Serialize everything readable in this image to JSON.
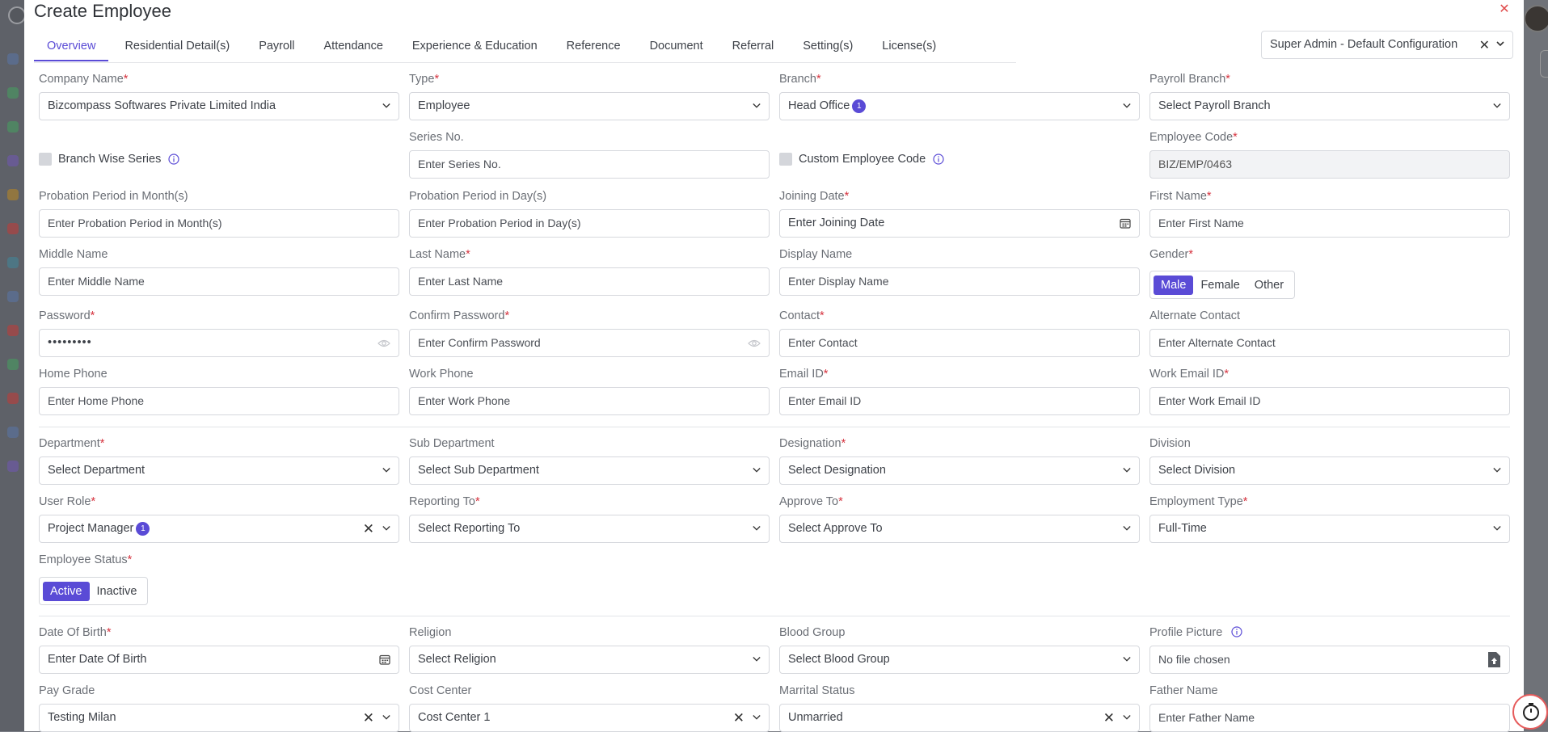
{
  "modal": {
    "title": "Create Employee",
    "config_select": "Super Admin - Default Configuration"
  },
  "tabs": [
    "Overview",
    "Residential Detail(s)",
    "Payroll",
    "Attendance",
    "Experience & Education",
    "Reference",
    "Document",
    "Referral",
    "Setting(s)",
    "License(s)"
  ],
  "colors": {
    "accent": "#5a4bd6",
    "required": "#d6333f",
    "close": "#e04b4b"
  },
  "form": {
    "company_name": {
      "label": "Company Name",
      "value": "Bizcompass Softwares Private Limited India"
    },
    "type": {
      "label": "Type",
      "value": "Employee"
    },
    "branch": {
      "label": "Branch",
      "value": "Head Office",
      "count": "1"
    },
    "payroll_branch": {
      "label": "Payroll Branch",
      "value": "Select Payroll Branch"
    },
    "branch_wise_series": {
      "label": "Branch Wise Series"
    },
    "series_no": {
      "label": "Series No.",
      "placeholder": "Enter Series No."
    },
    "custom_employee_code": {
      "label": "Custom Employee Code"
    },
    "employee_code": {
      "label": "Employee Code",
      "value": "BIZ/EMP/0463"
    },
    "probation_months": {
      "label": "Probation Period in Month(s)",
      "placeholder": "Enter Probation Period in Month(s)"
    },
    "probation_days": {
      "label": "Probation Period in Day(s)",
      "placeholder": "Enter Probation Period in Day(s)"
    },
    "joining_date": {
      "label": "Joining Date",
      "placeholder": "Enter Joining Date"
    },
    "first_name": {
      "label": "First Name",
      "placeholder": "Enter First Name"
    },
    "middle_name": {
      "label": "Middle Name",
      "placeholder": "Enter Middle Name"
    },
    "last_name": {
      "label": "Last Name",
      "placeholder": "Enter Last Name"
    },
    "display_name": {
      "label": "Display Name",
      "placeholder": "Enter Display Name"
    },
    "gender": {
      "label": "Gender",
      "options": [
        "Male",
        "Female",
        "Other"
      ],
      "selected": "Male"
    },
    "password": {
      "label": "Password",
      "value": "•••••••••"
    },
    "confirm_password": {
      "label": "Confirm Password",
      "placeholder": "Enter Confirm Password"
    },
    "contact": {
      "label": "Contact",
      "placeholder": "Enter Contact"
    },
    "alternate_contact": {
      "label": "Alternate Contact",
      "placeholder": "Enter Alternate Contact"
    },
    "home_phone": {
      "label": "Home Phone",
      "placeholder": "Enter Home Phone"
    },
    "work_phone": {
      "label": "Work Phone",
      "placeholder": "Enter Work Phone"
    },
    "email_id": {
      "label": "Email ID",
      "placeholder": "Enter Email ID"
    },
    "work_email_id": {
      "label": "Work Email ID",
      "placeholder": "Enter Work Email ID"
    },
    "department": {
      "label": "Department",
      "value": "Select Department"
    },
    "sub_department": {
      "label": "Sub Department",
      "value": "Select Sub Department"
    },
    "designation": {
      "label": "Designation",
      "value": "Select Designation"
    },
    "division": {
      "label": "Division",
      "value": "Select Division"
    },
    "user_role": {
      "label": "User Role",
      "value": "Project Manager",
      "count": "1"
    },
    "reporting_to": {
      "label": "Reporting To",
      "value": "Select Reporting To"
    },
    "approve_to": {
      "label": "Approve To",
      "value": "Select Approve To"
    },
    "employment_type": {
      "label": "Employment Type",
      "value": "Full-Time"
    },
    "employee_status": {
      "label": "Employee Status",
      "options": [
        "Active",
        "Inactive"
      ],
      "selected": "Active"
    },
    "date_of_birth": {
      "label": "Date Of Birth",
      "placeholder": "Enter Date Of Birth"
    },
    "religion": {
      "label": "Religion",
      "value": "Select Religion"
    },
    "blood_group": {
      "label": "Blood Group",
      "value": "Select Blood Group"
    },
    "profile_picture": {
      "label": "Profile Picture",
      "value": "No file chosen"
    },
    "pay_grade": {
      "label": "Pay Grade",
      "value": "Testing Milan"
    },
    "cost_center": {
      "label": "Cost Center",
      "value": "Cost Center 1"
    },
    "marital_status": {
      "label": "Marrital Status",
      "value": "Unmarried"
    },
    "father_name": {
      "label": "Father Name",
      "placeholder": "Enter Father Name"
    }
  }
}
